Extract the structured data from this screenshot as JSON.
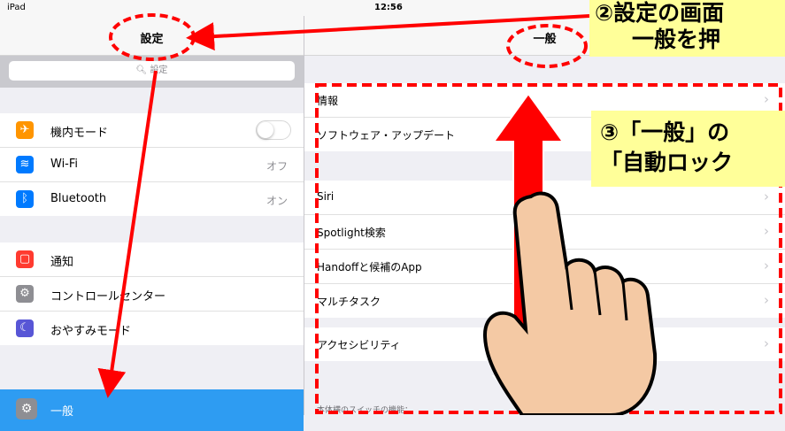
{
  "status_bar": {
    "device": "iPad",
    "time": "12:56"
  },
  "sidebar": {
    "title": "設定",
    "search_placeholder": "設定",
    "items": [
      {
        "label": "機内モード",
        "icon": "airplane-icon",
        "color": "#ff9500",
        "toggle": "off"
      },
      {
        "label": "Wi-Fi",
        "icon": "wifi-icon",
        "color": "#007aff",
        "value": "オフ"
      },
      {
        "label": "Bluetooth",
        "icon": "bluetooth-icon",
        "color": "#007aff",
        "value": "オン"
      },
      {
        "label": "通知",
        "icon": "notifications-icon",
        "color": "#ff3b30"
      },
      {
        "label": "コントロールセンター",
        "icon": "control-center-icon",
        "color": "#8e8e93"
      },
      {
        "label": "おやすみモード",
        "icon": "moon-icon",
        "color": "#5856d6"
      }
    ],
    "selected": {
      "label": "一般",
      "icon": "gear-icon",
      "color": "#2e9cf2"
    }
  },
  "main": {
    "title": "一般",
    "groups": [
      [
        "情報",
        "ソフトウェア・アップデート"
      ],
      [
        "Siri",
        "Spotlight検索",
        "Handoffと候補のApp",
        "マルチタスク"
      ],
      [
        "アクセシビリティ"
      ]
    ],
    "footer_note": "本体横のスイッチの機能："
  },
  "annotations": {
    "step2": [
      "②設定の画面",
      "一般を押"
    ],
    "step3": [
      "③「一般」の",
      "「自動ロック"
    ],
    "accent_color": "#ff0000",
    "callout_color": "#ffff99"
  }
}
